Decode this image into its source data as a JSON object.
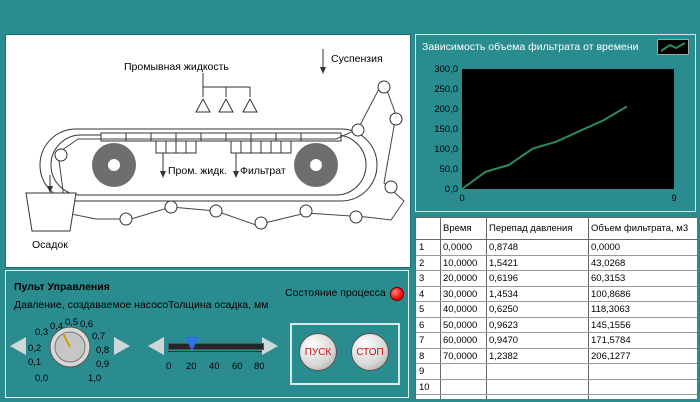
{
  "diagram": {
    "labels": {
      "suspension": "Суспензия",
      "wash_liquid": "Промывная жидкость",
      "wash_filtrate": "Пром. жидк.",
      "filtrate": "Фильтрат",
      "sediment": "Осадок"
    }
  },
  "chart_data": {
    "type": "line",
    "title": "Зависимость объема фильтрата от времени",
    "xlabel": "",
    "ylabel": "",
    "xlim": [
      0,
      9
    ],
    "ylim": [
      0,
      300
    ],
    "x_ticks": [
      "0",
      "9"
    ],
    "y_ticks": [
      "300,0",
      "250,0",
      "200,0",
      "150,0",
      "100,0",
      "50,0",
      "0,0"
    ],
    "series": [
      {
        "color": "#2e8b57",
        "x": [
          0,
          1,
          2,
          3,
          4,
          5,
          6,
          7
        ],
        "values": [
          0,
          43.0268,
          60.3153,
          100.8686,
          118.3063,
          145.1556,
          171.5784,
          206.1277
        ]
      }
    ],
    "legend": "top-right",
    "grid": false
  },
  "table": {
    "headers": [
      "Время",
      "Перепад давления",
      "Объем фильтрата, м3"
    ],
    "rows": [
      {
        "idx": "1",
        "time": "0,0000",
        "dp": "0,8748",
        "vol": "0,0000"
      },
      {
        "idx": "2",
        "time": "10,0000",
        "dp": "1,5421",
        "vol": "43,0268"
      },
      {
        "idx": "3",
        "time": "20,0000",
        "dp": "0,6196",
        "vol": "60,3153"
      },
      {
        "idx": "4",
        "time": "30,0000",
        "dp": "1,4534",
        "vol": "100,8686"
      },
      {
        "idx": "5",
        "time": "40,0000",
        "dp": "0,6250",
        "vol": "118,3063"
      },
      {
        "idx": "6",
        "time": "50,0000",
        "dp": "0,9623",
        "vol": "145,1556"
      },
      {
        "idx": "7",
        "time": "60,0000",
        "dp": "0,9470",
        "vol": "171,5784"
      },
      {
        "idx": "8",
        "time": "70,0000",
        "dp": "1,2382",
        "vol": "206,1277"
      },
      {
        "idx": "9",
        "time": "",
        "dp": "",
        "vol": ""
      },
      {
        "idx": "10",
        "time": "",
        "dp": "",
        "vol": ""
      }
    ]
  },
  "control": {
    "title": "Пульт Управления",
    "pressure_label": "Давление, создаваемое насосо",
    "thickness_label": "Толщина осадка, мм",
    "process_state_label": "Состояние процесса",
    "knob_scale": [
      "0,0",
      "0,1",
      "0,2",
      "0,3",
      "0,4",
      "0,5",
      "0,6",
      "0,7",
      "0,8",
      "0,9",
      "1,0"
    ],
    "knob_value": 0.4,
    "slider_scale": [
      "0",
      "20",
      "40",
      "60",
      "80"
    ],
    "slider_value": 20,
    "slider_max": 80,
    "start_label": "ПУСК",
    "stop_label": "СТОП",
    "led_color": "#ff1010"
  }
}
